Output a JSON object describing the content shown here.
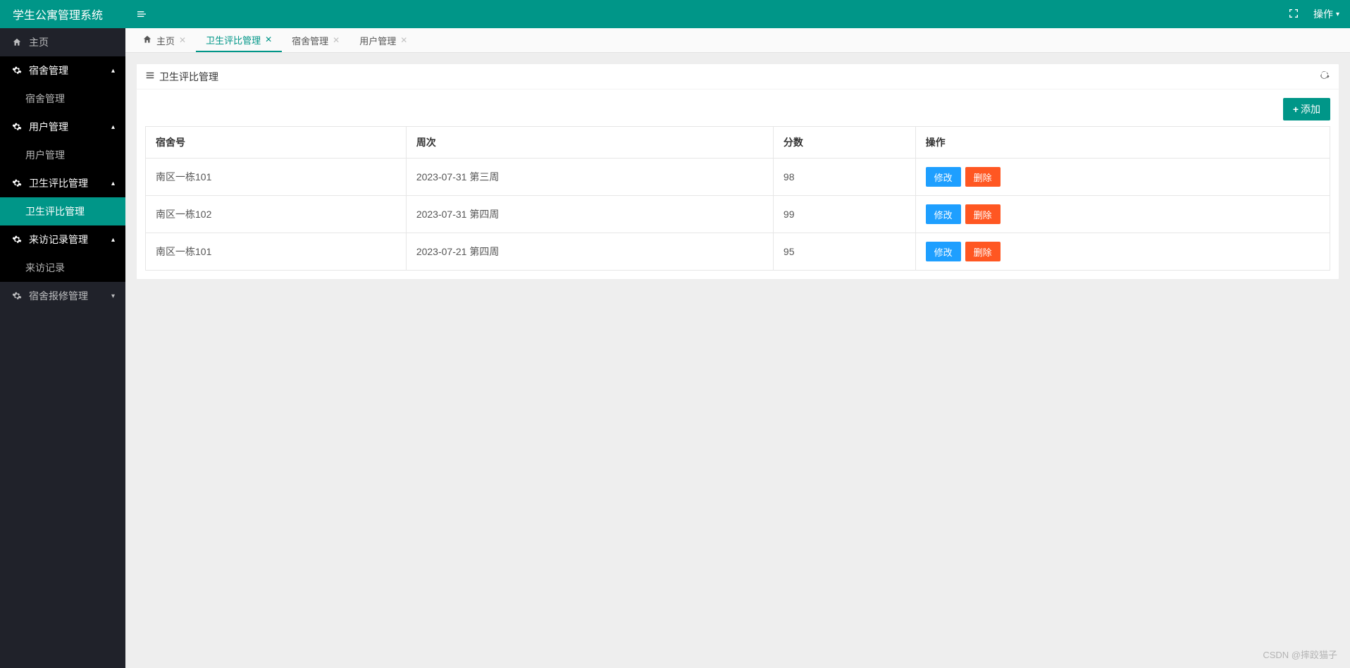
{
  "brand": {
    "title": "学生公寓管理系统"
  },
  "sidebar": {
    "home_label": "主页",
    "groups": [
      {
        "label": "宿舍管理",
        "children": [
          {
            "label": "宿舍管理",
            "active": false
          }
        ],
        "expanded": true
      },
      {
        "label": "用户管理",
        "children": [
          {
            "label": "用户管理",
            "active": false
          }
        ],
        "expanded": true
      },
      {
        "label": "卫生评比管理",
        "children": [
          {
            "label": "卫生评比管理",
            "active": true
          }
        ],
        "expanded": true
      },
      {
        "label": "来访记录管理",
        "children": [
          {
            "label": "来访记录",
            "active": false
          }
        ],
        "expanded": true
      },
      {
        "label": "宿舍报修管理",
        "children": [],
        "expanded": false
      }
    ]
  },
  "topbar": {
    "actions_label": "操作"
  },
  "tabs": [
    {
      "label": "主页",
      "closeable": true,
      "active": false,
      "is_home": true
    },
    {
      "label": "卫生评比管理",
      "closeable": true,
      "active": true,
      "is_home": false
    },
    {
      "label": "宿舍管理",
      "closeable": true,
      "active": false,
      "is_home": false
    },
    {
      "label": "用户管理",
      "closeable": true,
      "active": false,
      "is_home": false
    }
  ],
  "panel": {
    "title": "卫生评比管理",
    "add_button_label": "添加",
    "columns": {
      "c0": "宿舍号",
      "c1": "周次",
      "c2": "分数",
      "c3": "操作"
    },
    "row_actions": {
      "edit": "修改",
      "delete": "删除"
    },
    "rows": [
      {
        "dorm": "南区一栋101",
        "week": "2023-07-31 第三周",
        "score": "98"
      },
      {
        "dorm": "南区一栋102",
        "week": "2023-07-31 第四周",
        "score": "99"
      },
      {
        "dorm": "南区一栋101",
        "week": "2023-07-21 第四周",
        "score": "95"
      }
    ]
  },
  "watermark": "CSDN @摔跤猫子"
}
